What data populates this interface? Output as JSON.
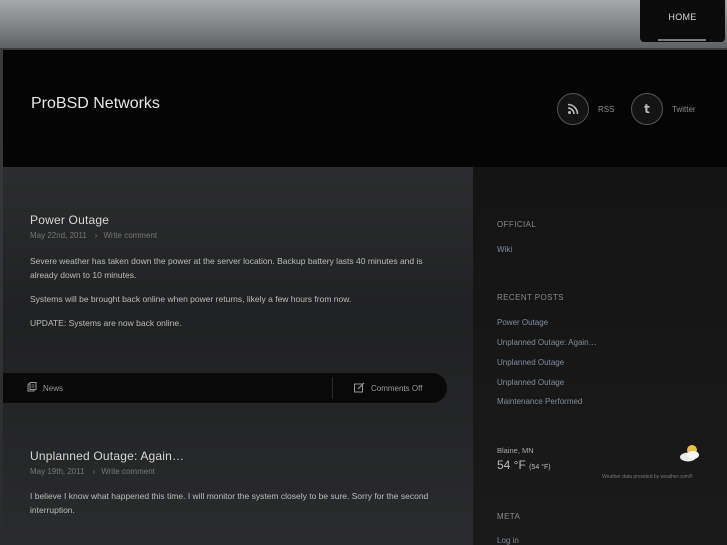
{
  "nav": {
    "home": "HOME"
  },
  "header": {
    "site_title": "ProBSD Networks",
    "rss_label": "RSS",
    "twitter_label": "Twitter",
    "twitter_glyph": "t"
  },
  "posts": [
    {
      "title": "Power Outage",
      "date": "May 22nd, 2011",
      "comment_link": "Write comment",
      "body": [
        "Severe weather has taken down the power at the server location.  Backup battery lasts 40 minutes and is already down to 10 minutes.",
        "Systems will be brought back online when power returns, likely a few hours from now.",
        "UPDATE:  Systems are now back online."
      ],
      "category": "News",
      "comments_status": "Comments Off"
    },
    {
      "title": "Unplanned Outage: Again…",
      "date": "May 19th, 2011",
      "comment_link": "Write comment",
      "body": [
        "I believe I know what happened this time.  I will monitor the system closely to be sure.  Sorry for the second interruption."
      ]
    }
  ],
  "sidebar": {
    "official_heading": "OFFICIAL",
    "official_links": [
      "Wiki"
    ],
    "recent_heading": "RECENT POSTS",
    "recent_links": [
      "Power Outage",
      "Unplanned Outage: Again…",
      "Unplanned Outage",
      "Unplanned Outage",
      "Maintenance Performed"
    ],
    "weather": {
      "location": "Blaine, MN",
      "temp": "54 °F",
      "temp_small": "(54 °F)",
      "credit": "Weather data provided by weather.com®"
    },
    "meta_heading": "META",
    "meta_links": [
      "Log in"
    ]
  },
  "icons": {
    "rss": "rss-icon",
    "twitter": "twitter-icon",
    "category": "category-icon",
    "comments": "comment-edit-icon",
    "weather": "partly-cloudy-icon"
  },
  "colors": {
    "link": "#7f8fa0",
    "header_bg": "#050505"
  }
}
